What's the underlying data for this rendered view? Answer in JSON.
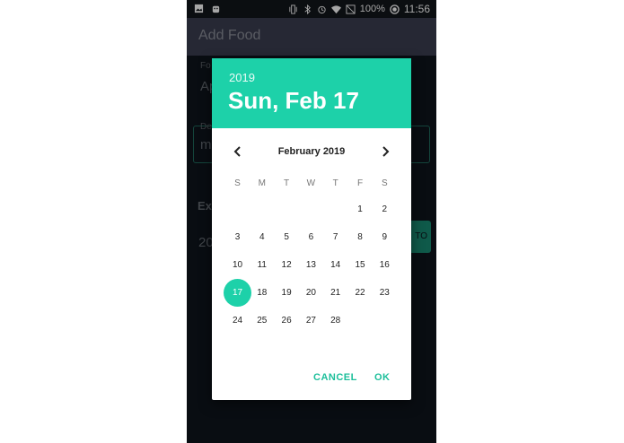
{
  "statusbar": {
    "battery": "100%",
    "time": "11:56",
    "left_icons": [
      "image-icon",
      "android-icon"
    ],
    "right_icons": [
      "vibrate-icon",
      "bluetooth-icon",
      "alarm-icon",
      "wifi-icon",
      "no-signal-icon",
      "battery-icon"
    ]
  },
  "appbar": {
    "title": "Add Food"
  },
  "background": {
    "label1": "Fo",
    "text1": "Ap",
    "label2": "De",
    "text2": "m",
    "section": "Ex",
    "value": "20",
    "button_fragment": "TO"
  },
  "datepicker": {
    "year": "2019",
    "date": "Sun, Feb 17",
    "month_label": "February 2019",
    "weekdays": [
      "S",
      "M",
      "T",
      "W",
      "T",
      "F",
      "S"
    ],
    "first_weekday_index": 5,
    "days_in_month": 28,
    "selected_day": 17,
    "cancel_label": "CANCEL",
    "ok_label": "OK",
    "accent_color": "#1dd1a9"
  }
}
